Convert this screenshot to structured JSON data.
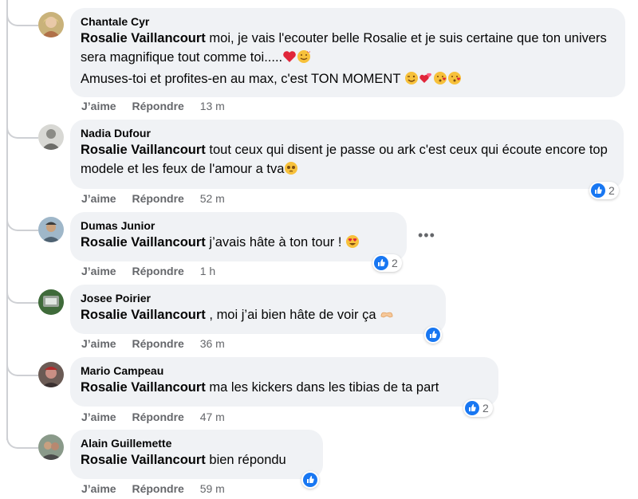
{
  "comments": [
    {
      "author": "Chantale Cyr",
      "mention": "Rosalie Vaillancourt",
      "text": " moi, je vais l'ecouter belle Rosalie et je suis certaine que ton univers sera magnifique tout comme toi.....",
      "text2": "Amuses-toi et profites-en au max, c'est TON MOMENT",
      "like_label": "J’aime",
      "reply_label": "Répondre",
      "time": "13 m"
    },
    {
      "author": "Nadia Dufour",
      "mention": "Rosalie Vaillancourt",
      "text": " tout ceux qui disent je passe ou ark c'est ceux qui écoute encore top modele et les feux de l'amour a tva",
      "like_label": "J’aime",
      "reply_label": "Répondre",
      "time": "52 m",
      "reaction_count": "2"
    },
    {
      "author": "Dumas Junior",
      "mention": "Rosalie Vaillancourt",
      "text": " j’avais hâte à ton tour ! ",
      "like_label": "J’aime",
      "reply_label": "Répondre",
      "time": "1 h",
      "reaction_count": "2",
      "more_label": "•••"
    },
    {
      "author": "Josee Poirier",
      "mention": "Rosalie Vaillancourt",
      "text": " , moi j’ai bien hâte de voir ça ",
      "like_label": "J’aime",
      "reply_label": "Répondre",
      "time": "36 m"
    },
    {
      "author": "Mario Campeau",
      "mention": "Rosalie Vaillancourt",
      "text": " ma les kickers dans les tibias de ta part",
      "like_label": "J’aime",
      "reply_label": "Répondre",
      "time": "47 m",
      "reaction_count": "2"
    },
    {
      "author": "Alain Guillemette",
      "mention": "Rosalie Vaillancourt",
      "text": " bien répondu",
      "like_label": "J’aime",
      "reply_label": "Répondre",
      "time": "59 m"
    }
  ],
  "colors": {
    "like_blue": "#1877f2",
    "bubble": "#f0f2f5",
    "meta": "#65676b",
    "line": "#ced0d4"
  }
}
